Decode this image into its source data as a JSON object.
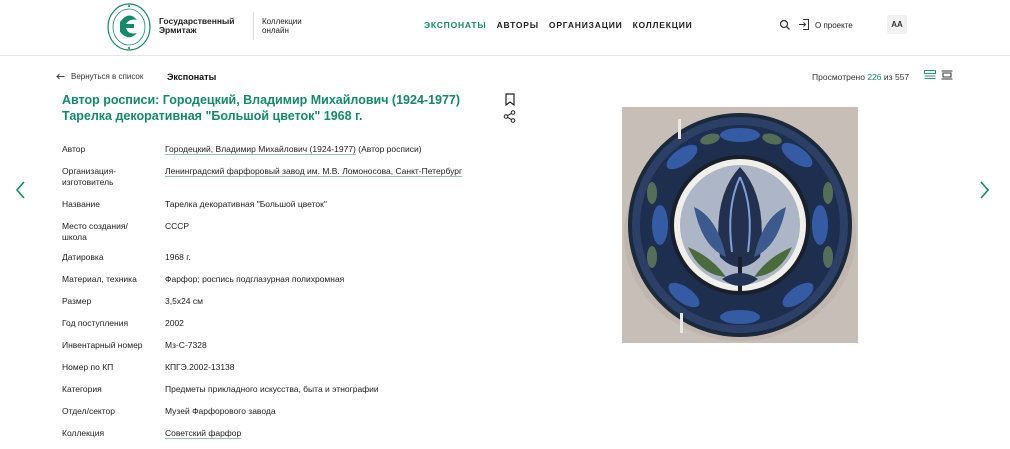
{
  "header": {
    "logo_text_line1": "Государственный",
    "logo_text_line2": "Эрмитаж",
    "collections_line1": "Коллекции",
    "collections_line2": "онлайн",
    "nav": [
      {
        "label": "ЭКСПОНАТЫ",
        "active": true
      },
      {
        "label": "АВТОРЫ",
        "active": false
      },
      {
        "label": "ОРГАНИЗАЦИИ",
        "active": false
      },
      {
        "label": "КОЛЛЕКЦИИ",
        "active": false
      }
    ],
    "about_label": "О проекте",
    "font_button": "AA",
    "accent_color": "#128a6b"
  },
  "subbar": {
    "back_label": "Вернуться в список",
    "section_title": "Экспонаты",
    "viewed_prefix": "Просмотрено",
    "viewed_current": "226",
    "viewed_mid": "из",
    "viewed_total": "557"
  },
  "item": {
    "title_line1": "Автор росписи: Городецкий, Владимир Михайлович (1924-1977)",
    "title_line2": "Тарелка декоративная \"Большой цветок\" 1968 г."
  },
  "properties": [
    {
      "label": "Автор",
      "value": "Городецкий, Владимир Михайлович (1924-1977)",
      "suffix": " (Автор росписи)",
      "link": true
    },
    {
      "label": "Организация-изготовитель",
      "value": "Ленинградский фарфоровый завод им. М.В. Ломоносова, Санкт-Петербург",
      "link": true
    },
    {
      "label": "Название",
      "value": "Тарелка декоративная \"Большой цветок\"",
      "link": false
    },
    {
      "label": "Место создания/ школа",
      "value": "СССР",
      "link": false
    },
    {
      "label": "Датировка",
      "value": "1968 г.",
      "link": false
    },
    {
      "label": "Материал, техника",
      "value": "Фарфор; роспись подглазурная полихромная",
      "link": false
    },
    {
      "label": "Размер",
      "value": "3,5x24 см",
      "link": false
    },
    {
      "label": "Год поступления",
      "value": "2002",
      "link": false
    },
    {
      "label": "Инвентарный номер",
      "value": "Мз-С-7328",
      "link": false
    },
    {
      "label": "Номер по КП",
      "value": "КПГЭ.2002-13138",
      "link": false
    },
    {
      "label": "Категория",
      "value": "Предметы прикладного искусства, быта и этнографии",
      "link": false
    },
    {
      "label": "Отдел/сектор",
      "value": "Музей Фарфорового завода",
      "link": false
    },
    {
      "label": "Коллекция",
      "value": "Советский фарфор",
      "link": true
    }
  ],
  "icons": {
    "search": "search-icon",
    "login": "login-icon",
    "bookmark": "bookmark-icon",
    "share": "share-icon",
    "prev": "chevron-left-icon",
    "next": "chevron-right-icon"
  }
}
